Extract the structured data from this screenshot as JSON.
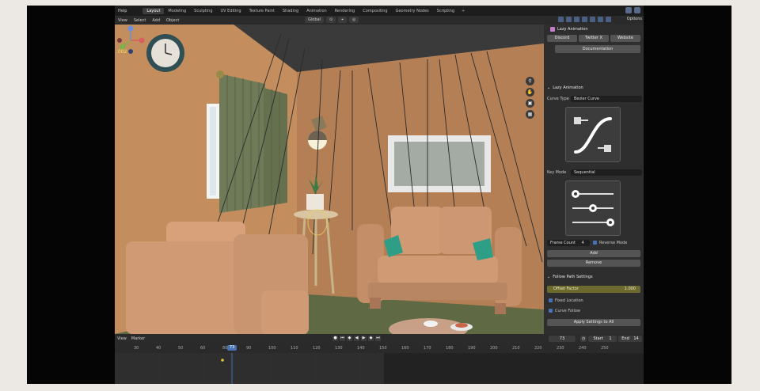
{
  "menubar": {
    "items": [
      "Help"
    ],
    "workspaces": [
      "Layout",
      "Modeling",
      "Sculpting",
      "UV Editing",
      "Texture Paint",
      "Shading",
      "Animation",
      "Rendering",
      "Compositing",
      "Geometry Nodes",
      "Scripting"
    ],
    "plus": "+"
  },
  "header": {
    "items": [
      "View",
      "Select",
      "Add",
      "Object"
    ],
    "transform": "Global",
    "options": "Options"
  },
  "panel": {
    "title": "Lazy Animation",
    "discord": "Discord",
    "twitter": "Twitter X",
    "website": "Website",
    "documentation": "Documentation",
    "section": "Lazy Animation",
    "curve_type_label": "Curve Type",
    "curve_type_value": "Bezier Curve",
    "key_mode_label": "Key Mode",
    "key_mode_value": "Sequential",
    "frame_count_label": "Frame Count",
    "frame_count_value": "4",
    "reverse_mode": "Reverse Mode",
    "add": "Add",
    "remove": "Remove",
    "follow_section": "Follow Path Settings",
    "offset_factor": "Offset Factor",
    "offset_value": "1.000",
    "fixed_location": "Fixed Location",
    "curve_follow": "Curve Follow",
    "apply_all": "Apply Settings to All"
  },
  "timeline": {
    "view": "View",
    "marker": "Marker",
    "current_frame": "73",
    "start_label": "Start",
    "start_value": "1",
    "end_label": "End",
    "end_value": "14",
    "playhead": "73",
    "ticks": [
      "30",
      "40",
      "50",
      "60",
      "80",
      "90",
      "100",
      "110",
      "120",
      "130",
      "140",
      "150",
      "160",
      "170",
      "180",
      "190",
      "200",
      "210",
      "220",
      "230",
      "240",
      "250"
    ]
  },
  "colors": {
    "accent": "#4772b3",
    "wall": "#c08a5c",
    "sofa": "#cf9a74",
    "curtain": "#6f7a58"
  }
}
